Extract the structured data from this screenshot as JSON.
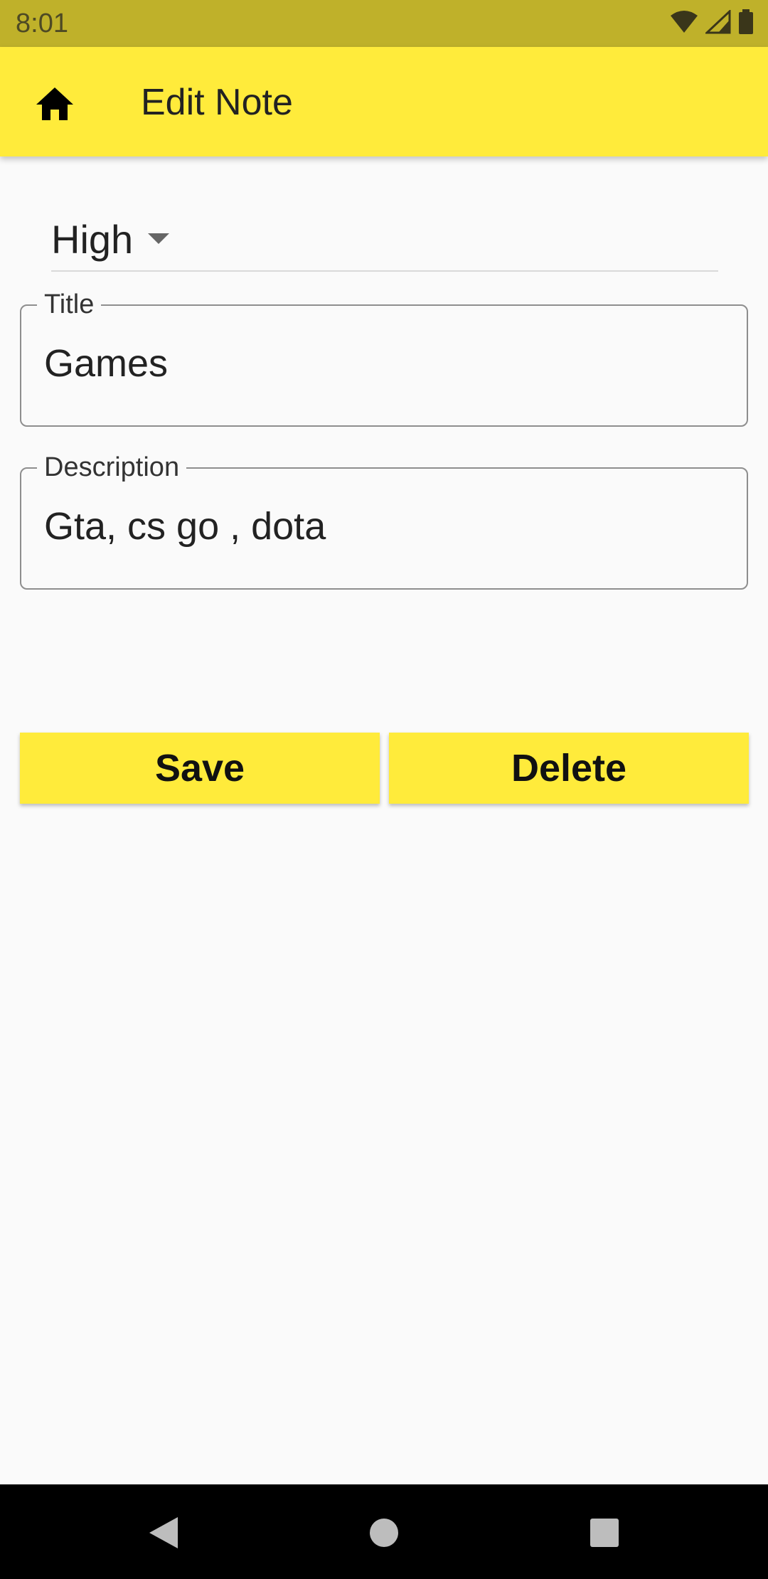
{
  "status_bar": {
    "time": "8:01",
    "icons": [
      "wifi-icon",
      "signal-icon",
      "battery-icon"
    ]
  },
  "app_bar": {
    "title": "Edit Note",
    "nav_icon": "home-icon"
  },
  "form": {
    "priority": {
      "selected": "High"
    },
    "title_field": {
      "label": "Title",
      "value": "Games"
    },
    "description_field": {
      "label": "Description",
      "value": "Gta, cs go , dota"
    }
  },
  "actions": {
    "save_label": "Save",
    "delete_label": "Delete"
  },
  "system_nav": {
    "buttons": [
      "back-icon",
      "home-circle-icon",
      "recents-icon"
    ]
  },
  "colors": {
    "accent": "#ffeb3b",
    "status_bar": "#bfb12a",
    "background": "#fafafa"
  }
}
